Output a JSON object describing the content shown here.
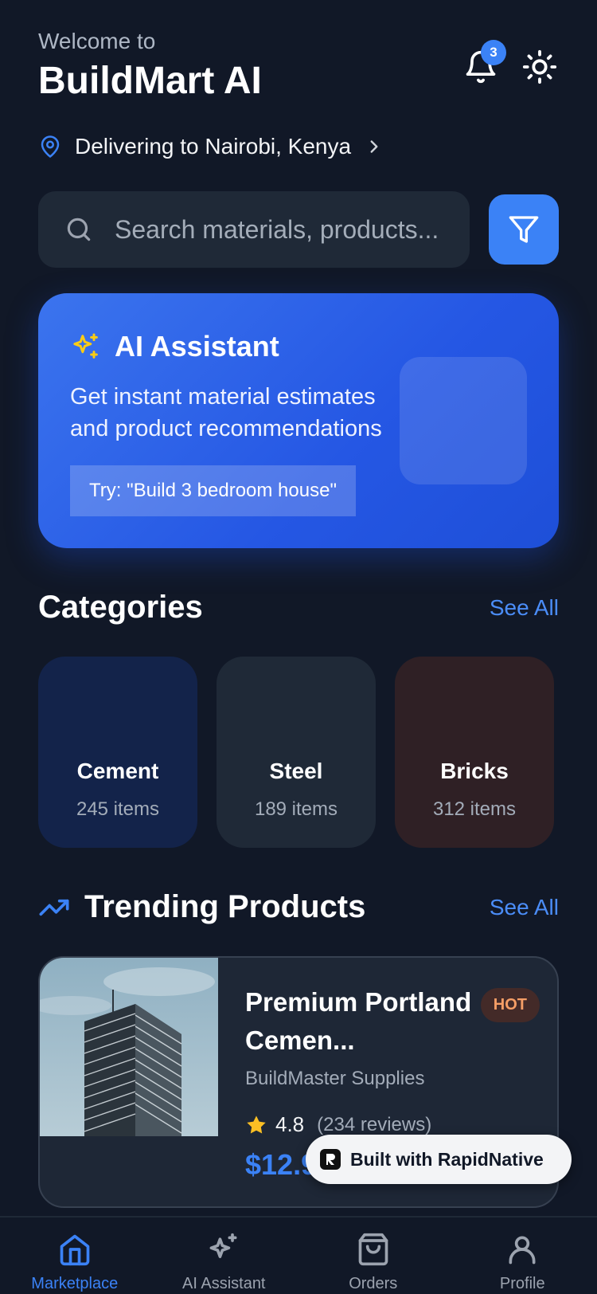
{
  "header": {
    "welcome": "Welcome to",
    "title": "BuildMart AI",
    "notification_count": "3"
  },
  "location": {
    "text": "Delivering to Nairobi, Kenya"
  },
  "search": {
    "placeholder": "Search materials, products..."
  },
  "ai_card": {
    "title": "AI Assistant",
    "description": "Get instant material estimates and product recommendations",
    "try_text": "Try: \"Build 3 bedroom house\""
  },
  "categories": {
    "title": "Categories",
    "see_all": "See All",
    "items": [
      {
        "name": "Cement",
        "count": "245 items",
        "color": "#13234a"
      },
      {
        "name": "Steel",
        "count": "189 items",
        "color": "#1f2937"
      },
      {
        "name": "Bricks",
        "count": "312 items",
        "color": "#2f2025"
      }
    ]
  },
  "trending": {
    "title": "Trending Products",
    "see_all": "See All",
    "product": {
      "name": "Premium Portland Cemen...",
      "badge": "HOT",
      "supplier": "BuildMaster Supplies",
      "rating": "4.8",
      "reviews": "(234 reviews)",
      "price": "$12.9"
    }
  },
  "rapid_pill": {
    "label": "Built with RapidNative"
  },
  "bottom_nav": {
    "items": [
      {
        "label": "Marketplace",
        "icon": "home-icon"
      },
      {
        "label": "AI Assistant",
        "icon": "sparkles-icon"
      },
      {
        "label": "Orders",
        "icon": "shopping-bag-icon"
      },
      {
        "label": "Profile",
        "icon": "user-icon"
      }
    ]
  },
  "colors": {
    "background": "#111827",
    "accent": "#3b82f6",
    "card": "#1f2937"
  }
}
